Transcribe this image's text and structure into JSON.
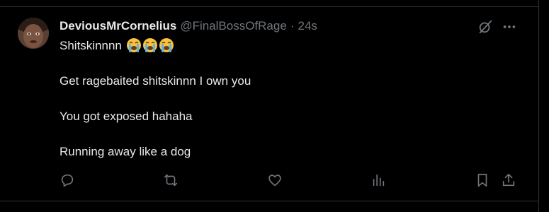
{
  "tweet": {
    "display_name": "DeviousMrCornelius",
    "handle": "@FinalBossOfRage",
    "separator": "·",
    "time": "24s",
    "lines": [
      "Shitskinnnn",
      "Get ragebaited shitskinnn I own you",
      "You got exposed hahaha",
      "Running away like a dog"
    ],
    "emoji": [
      "loudly-crying-face",
      "loudly-crying-face",
      "loudly-crying-face"
    ]
  },
  "icons": {
    "grok": "grok-icon",
    "more": "more-icon",
    "reply": "reply-icon",
    "retweet": "retweet-icon",
    "like": "like-icon",
    "views": "views-icon",
    "bookmark": "bookmark-icon",
    "share": "share-icon"
  },
  "colors": {
    "background": "#000000",
    "text_primary": "#e7e9ea",
    "text_secondary": "#71767b",
    "border": "#2f3336"
  }
}
